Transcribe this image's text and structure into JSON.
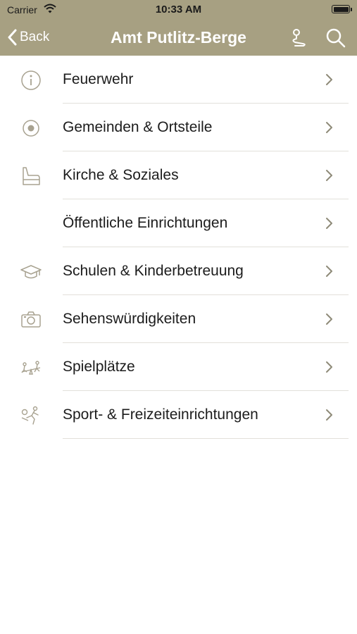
{
  "status": {
    "carrier": "Carrier",
    "time": "10:33 AM"
  },
  "nav": {
    "back_label": "Back",
    "title": "Amt Putlitz-Berge"
  },
  "colors": {
    "accent": "#a7a082",
    "chevron": "#8e8a78",
    "icon": "#a8a290"
  },
  "items": [
    {
      "label": "Feuerwehr",
      "icon": "info-icon"
    },
    {
      "label": "Gemeinden & Ortsteile",
      "icon": "target-icon"
    },
    {
      "label": "Kirche & Soziales",
      "icon": "church-chair-icon"
    },
    {
      "label": "Öffentliche Einrichtungen",
      "icon": ""
    },
    {
      "label": "Schulen & Kinderbetreuung",
      "icon": "graduation-cap-icon"
    },
    {
      "label": "Sehenswürdigkeiten",
      "icon": "camera-icon"
    },
    {
      "label": "Spielplätze",
      "icon": "playground-icon"
    },
    {
      "label": "Sport- & Freizeiteinrichtungen",
      "icon": "sport-icon"
    }
  ]
}
